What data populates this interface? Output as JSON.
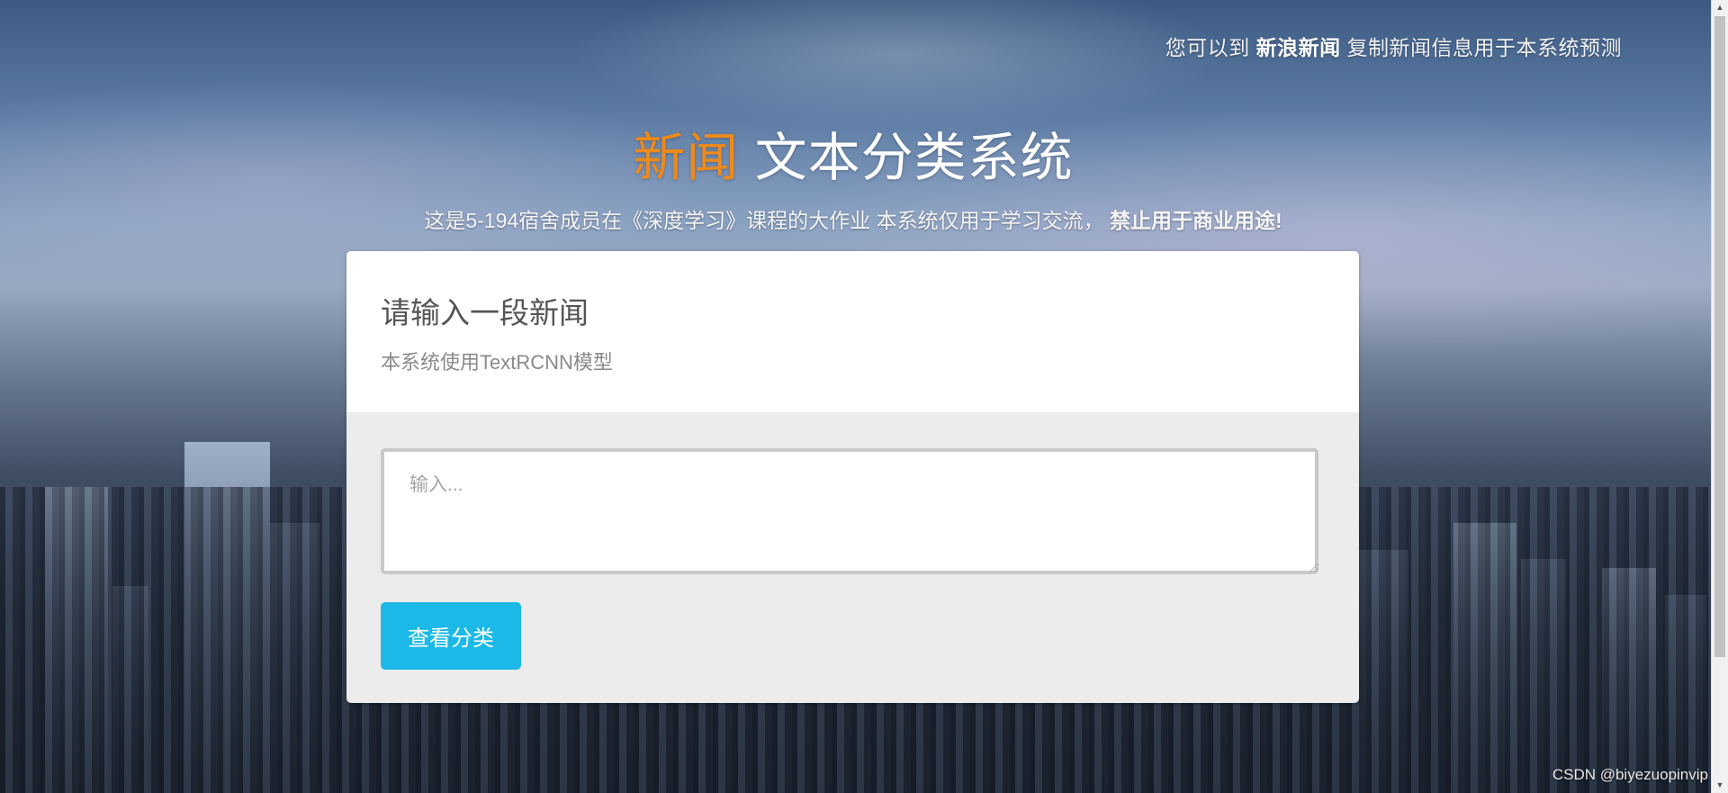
{
  "header": {
    "note_prefix": "您可以到",
    "note_link": "新浪新闻",
    "note_suffix": "复制新闻信息用于本系统预测"
  },
  "hero": {
    "title_accent": "新闻",
    "title_rest": "文本分类系统",
    "subtitle_main": "这是5-194宿舍成员在《深度学习》课程的大作业 本系统仅用于学习交流，",
    "subtitle_strong": "禁止用于商业用途!"
  },
  "card": {
    "title": "请输入一段新闻",
    "description": "本系统使用TextRCNN模型",
    "input_placeholder": "输入...",
    "input_value": "",
    "submit_label": "查看分类"
  },
  "footer": {
    "watermark": "CSDN @biyezuopinvip"
  },
  "colors": {
    "accent": "#ee8a19",
    "button": "#1bb8e8"
  }
}
